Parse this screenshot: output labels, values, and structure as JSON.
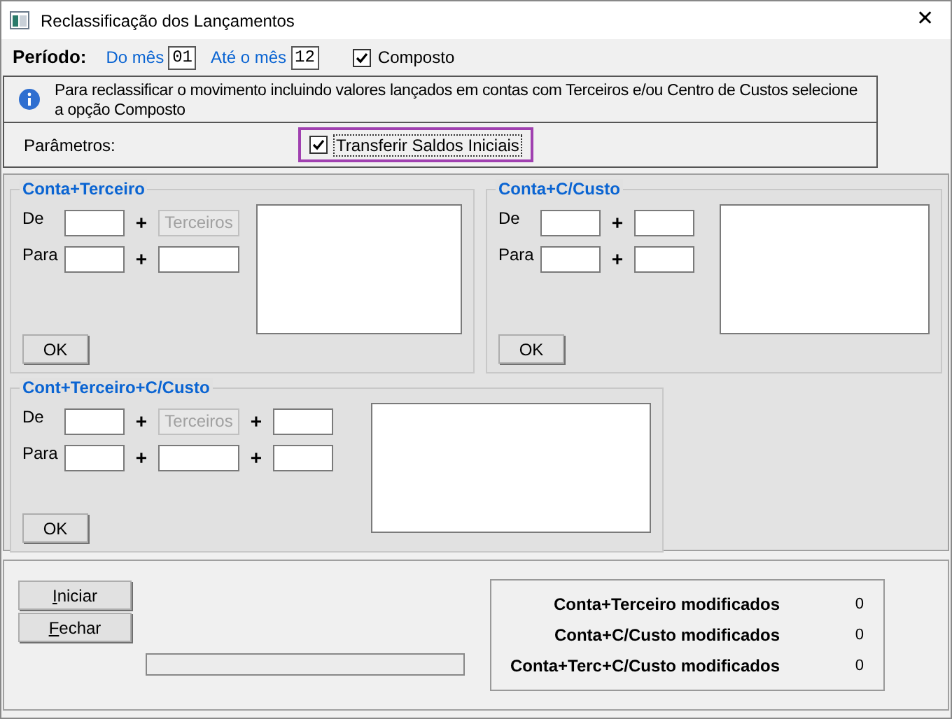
{
  "window": {
    "title": "Reclassificação dos Lançamentos",
    "close": "✕"
  },
  "period": {
    "label": "Período:",
    "from_label": "Do mês",
    "from_value": "01",
    "to_label": "Até o mês",
    "to_value": "12",
    "composite": {
      "label": "Composto",
      "checked": true
    }
  },
  "info": "Para reclassificar o movimento incluindo valores lançados em contas com Terceiros e/ou Centro de Custos selecione a opção Composto",
  "parameters": {
    "label": "Parâmetros:",
    "transfer": {
      "label": "Transferir Saldos Iniciais",
      "checked": true,
      "highlighted": true
    }
  },
  "groups": [
    {
      "title": "Conta+Terceiro",
      "rows": [
        {
          "label": "De",
          "fields": [
            {
              "kind": "input"
            },
            {
              "kind": "button",
              "label": "Terceiros",
              "disabled": true
            }
          ]
        },
        {
          "label": "Para",
          "fields": [
            {
              "kind": "input"
            },
            {
              "kind": "input"
            }
          ]
        }
      ],
      "ok": "OK"
    },
    {
      "title": "Conta+C/Custo",
      "rows": [
        {
          "label": "De",
          "fields": [
            {
              "kind": "input"
            },
            {
              "kind": "input"
            }
          ]
        },
        {
          "label": "Para",
          "fields": [
            {
              "kind": "input"
            },
            {
              "kind": "input"
            }
          ]
        }
      ],
      "ok": "OK"
    },
    {
      "title": "Cont+Terceiro+C/Custo",
      "rows": [
        {
          "label": "De",
          "fields": [
            {
              "kind": "input"
            },
            {
              "kind": "button",
              "label": "Terceiros",
              "disabled": true
            },
            {
              "kind": "input"
            }
          ]
        },
        {
          "label": "Para",
          "fields": [
            {
              "kind": "input"
            },
            {
              "kind": "input"
            },
            {
              "kind": "input"
            }
          ]
        }
      ],
      "ok": "OK"
    }
  ],
  "plus": "+",
  "actions": [
    {
      "label": "Iniciar"
    },
    {
      "label": "Fechar"
    }
  ],
  "progress": {
    "level": 0
  },
  "summary": [
    {
      "label": "Conta+Terceiro modificados",
      "value": "0"
    },
    {
      "label": "Conta+C/Custo modificados",
      "value": "0"
    },
    {
      "label": "Conta+Terc+C/Custo modificados",
      "value": "0"
    }
  ]
}
